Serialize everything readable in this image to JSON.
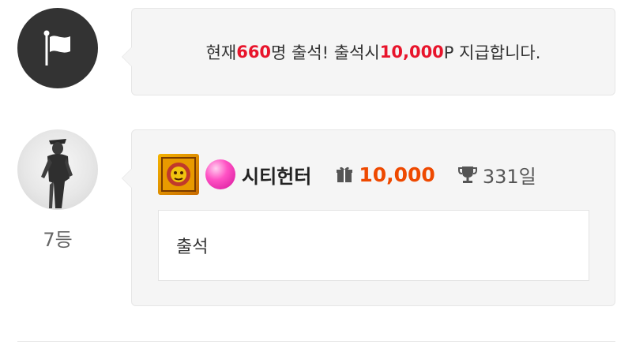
{
  "notice": {
    "prefix": "현재 ",
    "count": "660",
    "middle": "명 출석! 출석시 ",
    "points": "10,000",
    "suffix": "P 지급합니다."
  },
  "entry": {
    "rank": "7등",
    "nickname": "시티헌터",
    "points": "10,000",
    "days": "331일",
    "comment": "출석"
  },
  "icons": {
    "notice": "flag-icon",
    "gift": "gift-icon",
    "trophy": "trophy-icon",
    "level": "level-badge-icon",
    "gem": "pink-gem-icon"
  },
  "colors": {
    "highlight_red": "#e8142b",
    "points_orange": "#ee4900",
    "bubble_bg": "#f5f5f5"
  }
}
